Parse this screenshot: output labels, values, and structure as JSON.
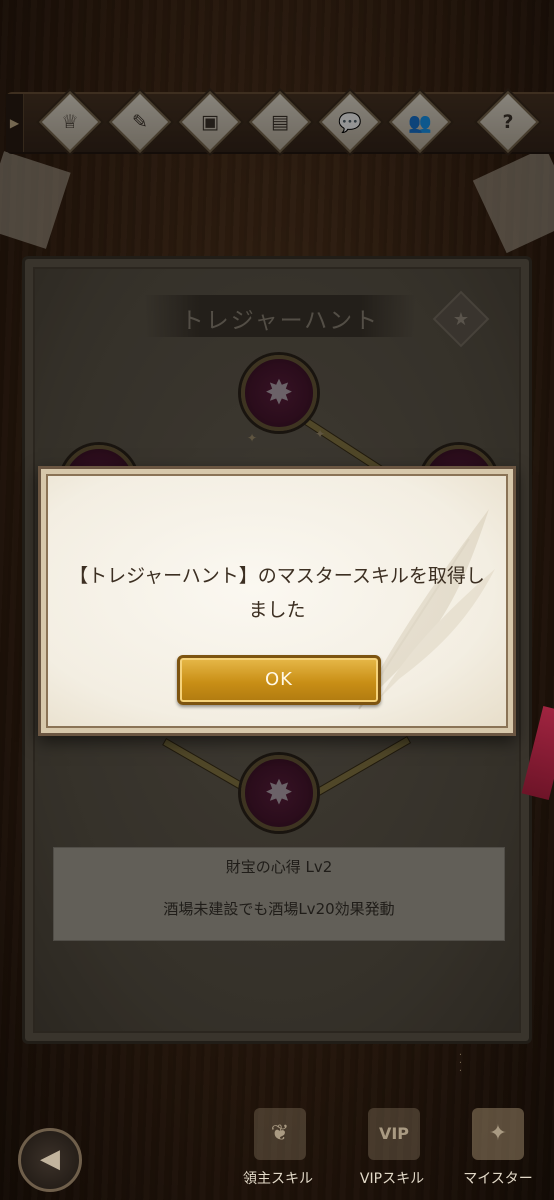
{
  "toolbar": {
    "expand_glyph": "▶",
    "buttons": [
      {
        "icon": "ribbon-icon",
        "glyph": "♕"
      },
      {
        "icon": "book-quill-icon",
        "glyph": "✎"
      },
      {
        "icon": "chest-icon",
        "glyph": "▣"
      },
      {
        "icon": "scroll-icon",
        "glyph": "▤"
      },
      {
        "icon": "chat-icon",
        "glyph": "💬"
      },
      {
        "icon": "guild-members-icon",
        "glyph": "👥"
      },
      {
        "icon": "help-icon",
        "glyph": "?"
      }
    ]
  },
  "panel": {
    "title": "トレジャーハント",
    "badge_glyph": "★"
  },
  "skill": {
    "node_glyph": "✸",
    "name": "財宝の心得 Lv2",
    "description": "酒場未建設でも酒場Lv20効果発動"
  },
  "dialog": {
    "message": "【トレジャーハント】のマスタースキルを取得しました",
    "ok_label": "OK"
  },
  "bottom_nav": {
    "back_glyph": "◀",
    "tabs": [
      {
        "label": "領主スキル",
        "glyph": "❦"
      },
      {
        "label": "VIPスキル",
        "glyph": "VIP"
      },
      {
        "label": "マイスター",
        "glyph": "✦"
      }
    ]
  }
}
